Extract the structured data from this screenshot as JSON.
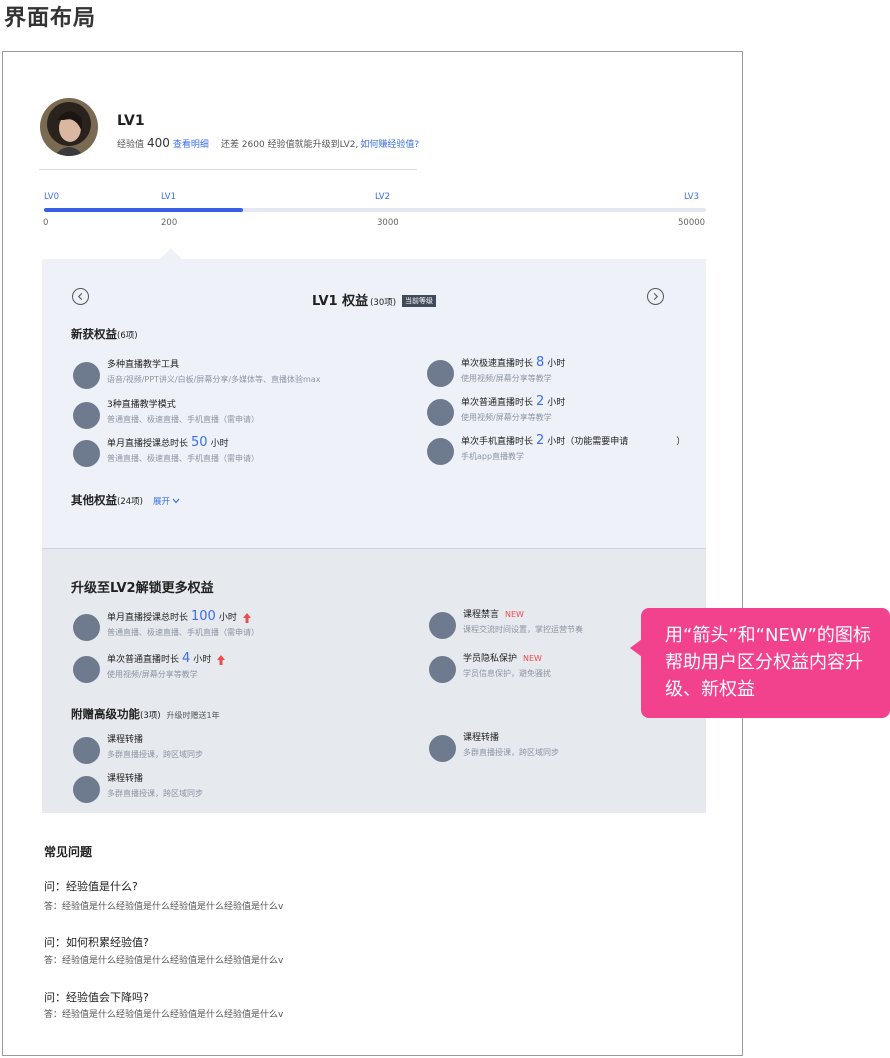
{
  "page_title": "界面布局",
  "user": {
    "level": "LV1",
    "exp_label": "经验值",
    "exp_value": "400",
    "detail_link": "查看明细",
    "upgrade_hint_prefix": "还差 2600 经验值就能升级到LV2,",
    "upgrade_hint_link": "如何赚经验值?"
  },
  "progress": {
    "levels": [
      {
        "label": "LV0",
        "value": "0"
      },
      {
        "label": "LV1",
        "value": "200"
      },
      {
        "label": "LV2",
        "value": "3000"
      },
      {
        "label": "LV3",
        "value": "50000"
      }
    ],
    "fill_percent": 30
  },
  "rights": {
    "title": "LV1 权益",
    "count": "(30项)",
    "badge": "当前等级",
    "new_section": {
      "title": "新获权益",
      "count": "(6项)"
    },
    "items_left": [
      {
        "title": "多种直播教学工具",
        "desc": "语音/视频/PPT讲义/白板/屏幕分享/多媒体等、直播体验max"
      },
      {
        "title": "3种直播教学模式",
        "desc": "普通直播、极速直播、手机直播（需申请）"
      },
      {
        "title_pre": "单月直播授课总时长",
        "big": "50",
        "title_post": "小时",
        "desc": "普通直播、极速直播、手机直播（需申请）"
      }
    ],
    "items_right": [
      {
        "title_pre": "单次极速直播时长",
        "big": "8",
        "title_post": "小时",
        "desc": "使用视频/屏幕分享等教学"
      },
      {
        "title_pre": "单次普通直播时长",
        "big": "2",
        "title_post": "小时",
        "desc": "使用视频/屏幕分享等教学"
      },
      {
        "title_pre": "单次手机直播时长",
        "big": "2",
        "title_post": "小时（功能需要申请",
        "title_close": "）",
        "desc": "手机app直播教学"
      }
    ],
    "other_section": {
      "title": "其他权益",
      "count": "(24项)",
      "expand": "展开"
    }
  },
  "upgrade": {
    "title": "升级至LV2解锁更多权益",
    "items_left": [
      {
        "title_pre": "单月直播授课总时长",
        "big": "100",
        "title_post": "小时",
        "desc": "普通直播、极速直播、手机直播（需申请）"
      },
      {
        "title_pre": "单次普通直播时长",
        "big": "4",
        "title_post": "小时",
        "desc": "使用视频/屏幕分享等教学"
      }
    ],
    "items_right": [
      {
        "title": "课程禁言",
        "tag": "NEW",
        "desc": "课程交流时间设置，掌控运营节奏"
      },
      {
        "title": "学员隐私保护",
        "tag": "NEW",
        "desc": "学员信息保护，避免骚扰"
      }
    ],
    "gift": {
      "title": "附赠高级功能",
      "count": "(3项)",
      "note": "升级时赠送1年"
    },
    "gift_items": [
      {
        "title": "课程转播",
        "desc": "多群直播授课，跨区域同步"
      },
      {
        "title": "课程转播",
        "desc": "多群直播授课，跨区域同步"
      },
      {
        "title": "课程转播",
        "desc": "多群直播授课，跨区域同步"
      }
    ]
  },
  "faq": {
    "title": "常见问题",
    "items": [
      {
        "q": "问：经验值是什么?",
        "a": "答：经验值是什么经验值是什么经验值是什么经验值是什么v"
      },
      {
        "q": "问：如何积累经验值?",
        "a": "答：经验值是什么经验值是什么经验值是什么经验值是什么v"
      },
      {
        "q": "问：经验值会下降吗?",
        "a": "答：经验值是什么经验值是什么经验值是什么经验值是什么v"
      }
    ]
  },
  "callout": {
    "text": "用“箭头”和“NEW”的图标帮助用户区分权益内容升级、新权益"
  },
  "colors": {
    "accent": "#3a6df0",
    "progress_fill": "#3a5ee8",
    "callout": "#f2418d",
    "new_tag": "#f04c4c",
    "icon_dot": "#6e7a8e"
  }
}
